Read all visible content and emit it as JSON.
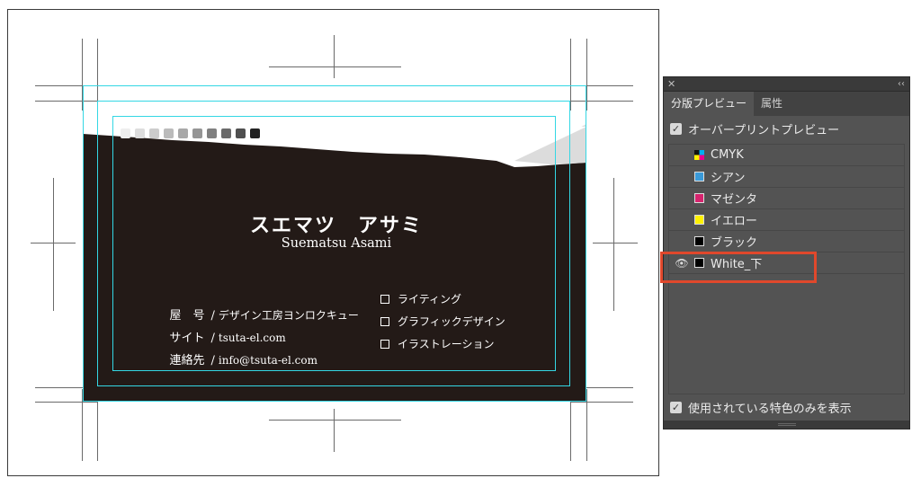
{
  "card": {
    "name_jp": "スエマツ　アサミ",
    "name_en": "Suematsu Asami",
    "info": [
      {
        "key": "屋　号",
        "sep": "/",
        "value": "デザイン工房ヨンロクキュー"
      },
      {
        "key": "サイト",
        "sep": "/",
        "value": "tsuta-el.com"
      },
      {
        "key": "連絡先",
        "sep": "/",
        "value": "info@tsuta-el.com"
      }
    ],
    "services": [
      "ライティング",
      "グラフィックデザイン",
      "イラストレーション"
    ],
    "background_color": "#231a17",
    "guide_color": "#34d7e4"
  },
  "panel": {
    "close_glyph": "✕",
    "collapse_glyph": "‹‹",
    "tabs": [
      {
        "label": "分版プレビュー",
        "active": true
      },
      {
        "label": "属性",
        "active": false
      }
    ],
    "overprint_label": "オーバープリントプレビュー",
    "overprint_checked": true,
    "separations": [
      {
        "name": "CMYK",
        "color": "cmyk",
        "visible": false
      },
      {
        "name": "シアン",
        "color": "#3a9ad9",
        "visible": false
      },
      {
        "name": "マゼンタ",
        "color": "#d6246e",
        "visible": false
      },
      {
        "name": "イエロー",
        "color": "#fff200",
        "visible": false
      },
      {
        "name": "ブラック",
        "color": "#000000",
        "visible": false
      },
      {
        "name": "White_下",
        "color": "#000000",
        "visible": true
      }
    ],
    "spot_only_label": "使用されている特色のみを表示",
    "spot_only_checked": true,
    "highlight_color": "#e0482c",
    "eye_icon": "👁",
    "check_glyph": "✓"
  }
}
